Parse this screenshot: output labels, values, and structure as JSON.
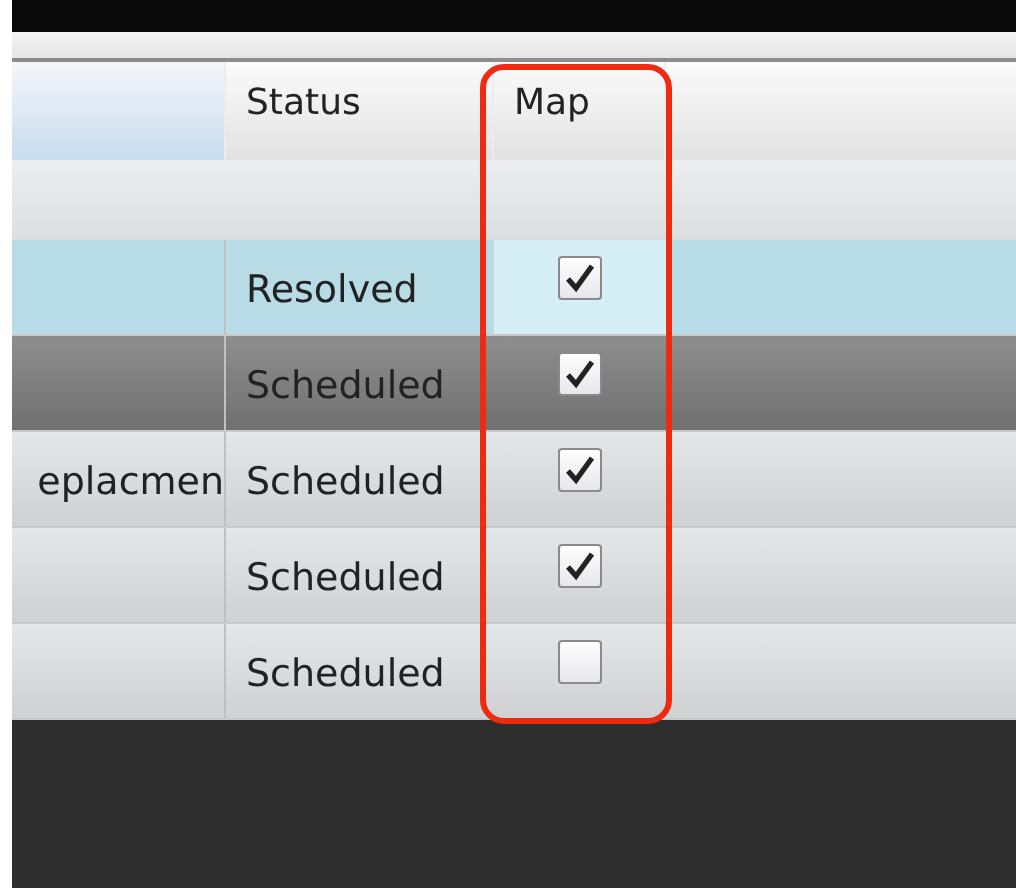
{
  "table": {
    "columns": [
      {
        "highlighted": false
      },
      {
        "label": "Status",
        "highlighted": false
      },
      {
        "label": "Map",
        "highlighted": true
      }
    ],
    "rows": [
      {
        "column_1": null,
        "status": "Resolved",
        "map_checked": true,
        "selected": true,
        "hovered": false
      },
      {
        "column_1": null,
        "status": "Scheduled",
        "map_checked": true,
        "selected": false,
        "hovered": true
      },
      {
        "column_1": "eplacmen",
        "status": "Scheduled",
        "map_checked": true,
        "selected": false,
        "hovered": false
      },
      {
        "column_1": null,
        "status": "Scheduled",
        "map_checked": true,
        "selected": false,
        "hovered": false
      },
      {
        "column_1": null,
        "status": "Scheduled",
        "map_checked": false,
        "selected": false,
        "hovered": false
      }
    ]
  }
}
